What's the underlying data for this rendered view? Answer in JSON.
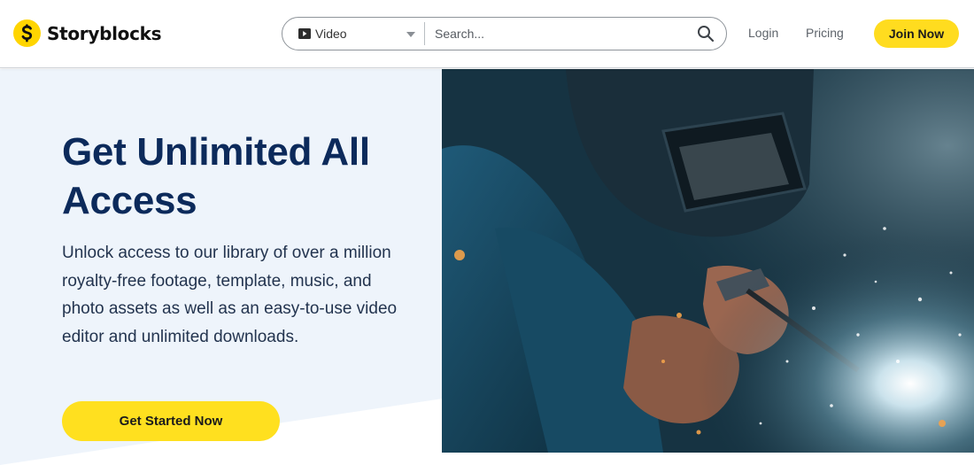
{
  "header": {
    "brand": "Storyblocks",
    "search": {
      "type_label": "Video",
      "placeholder": "Search..."
    },
    "nav": {
      "login": "Login",
      "pricing": "Pricing",
      "join": "Join Now"
    }
  },
  "hero": {
    "heading": "Get Unlimited All Access",
    "body": "Unlock access to our library of over a million royalty-free footage, template, music, and photo assets as well as an easy-to-use video editor and unlimited downloads.",
    "cta": "Get Started Now"
  },
  "colors": {
    "brand_yellow": "#ffd500",
    "heading_navy": "#0c2a5b",
    "hero_bg": "#eef4fb"
  }
}
